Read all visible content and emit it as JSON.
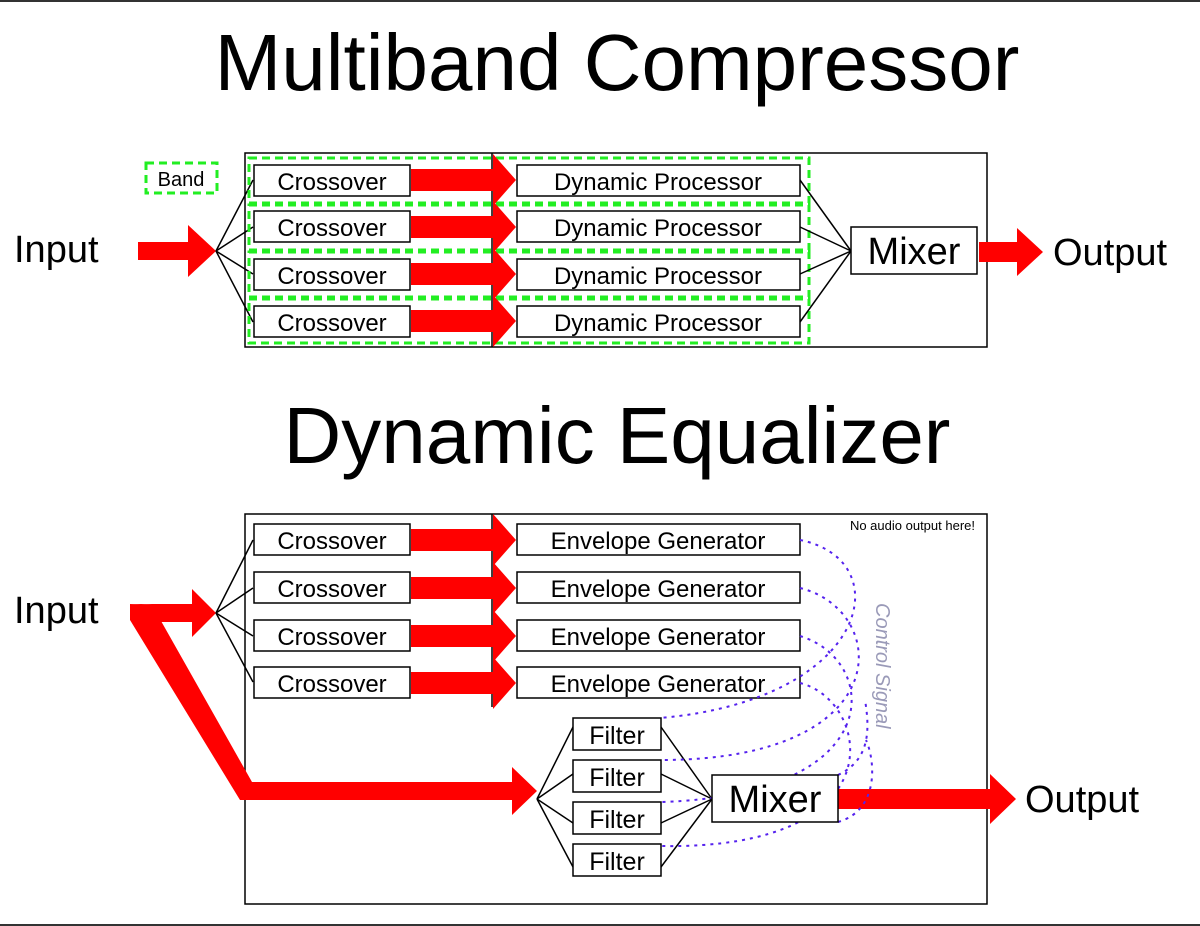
{
  "multiband": {
    "title": "Multiband Compressor",
    "input_label": "Input",
    "output_label": "Output",
    "legend_label": "Band",
    "crossovers": [
      "Crossover",
      "Crossover",
      "Crossover",
      "Crossover"
    ],
    "processors": [
      "Dynamic Processor",
      "Dynamic Processor",
      "Dynamic Processor",
      "Dynamic Processor"
    ],
    "mixer": "Mixer"
  },
  "dynamic_eq": {
    "title": "Dynamic Equalizer",
    "input_label": "Input",
    "output_label": "Output",
    "crossovers": [
      "Crossover",
      "Crossover",
      "Crossover",
      "Crossover"
    ],
    "envelopes": [
      "Envelope Generator",
      "Envelope Generator",
      "Envelope Generator",
      "Envelope Generator"
    ],
    "filters": [
      "Filter",
      "Filter",
      "Filter",
      "Filter"
    ],
    "mixer": "Mixer",
    "note": "No audio output here!",
    "control_label": "Control Signal"
  },
  "colors": {
    "signal_arrow": "#ff0000",
    "band_outline": "#22ee22",
    "control_signal": "#5522ee"
  }
}
